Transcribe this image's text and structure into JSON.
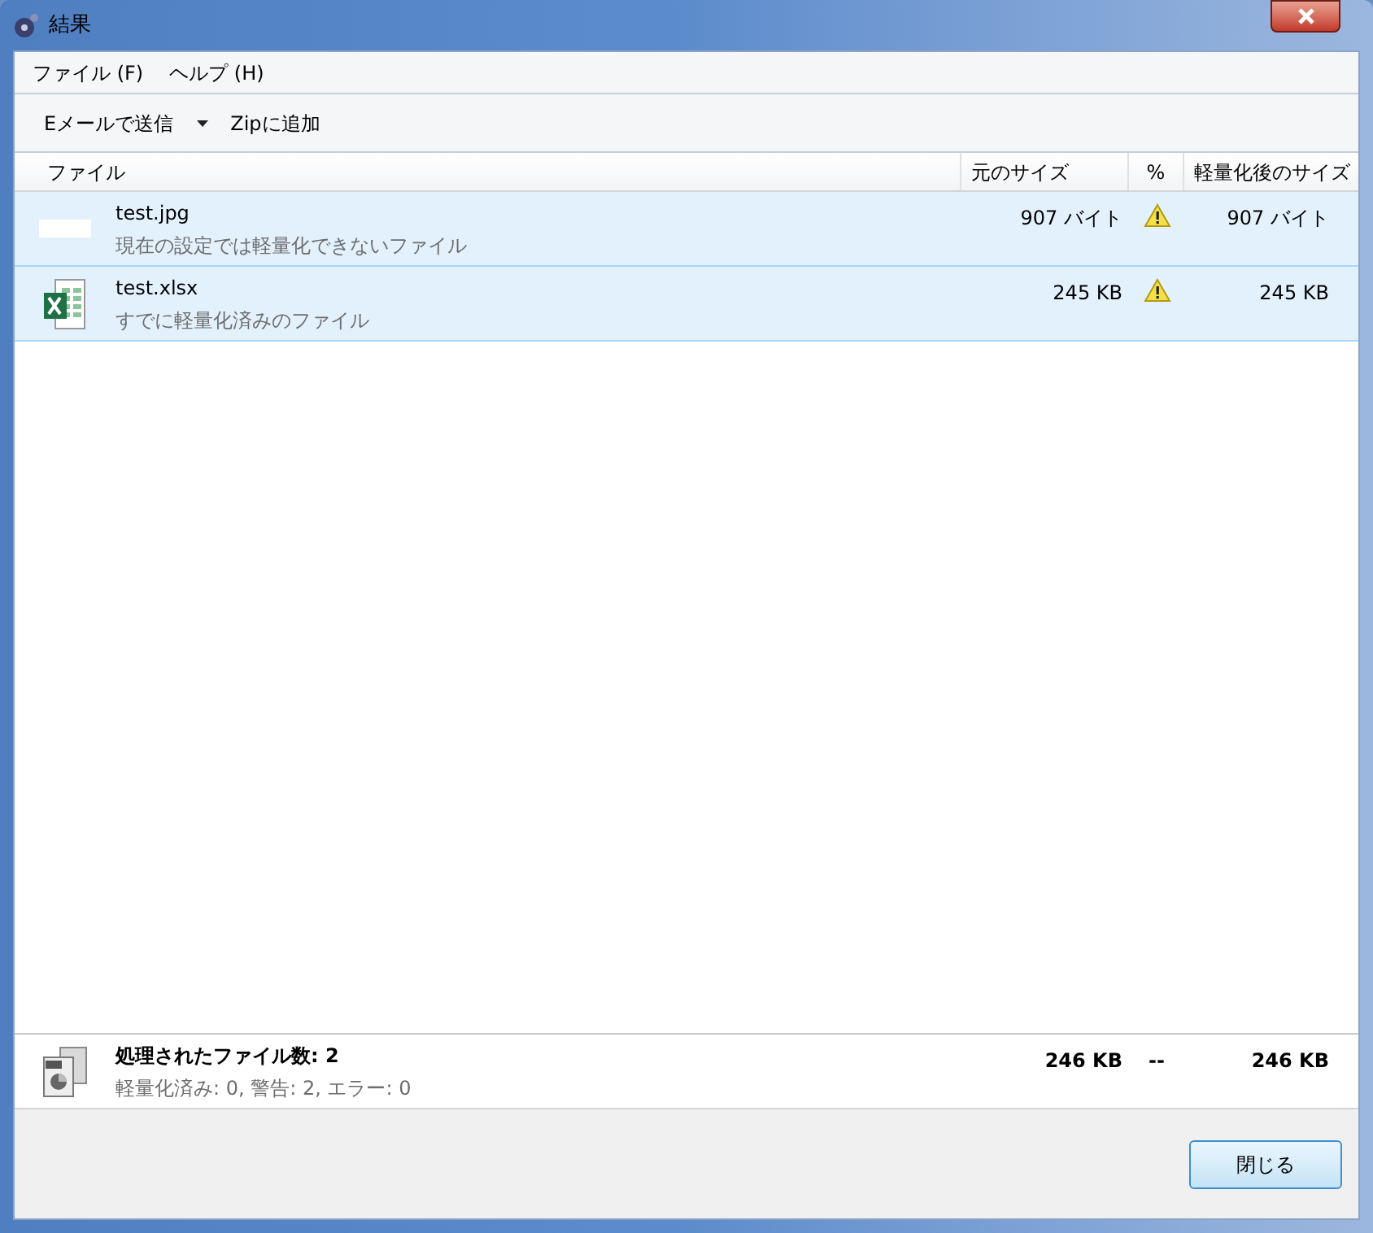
{
  "window": {
    "title": "結果"
  },
  "menu": [
    "ファイル (F)",
    "ヘルプ (H)"
  ],
  "toolbar": [
    {
      "label": "Eメールで送信",
      "dropdown": true
    },
    {
      "label": "Zipに追加",
      "dropdown": false
    }
  ],
  "table": {
    "columns": [
      "ファイル",
      "元のサイズ",
      "%",
      "軽量化後のサイズ"
    ],
    "rows": [
      {
        "kind": "image",
        "name": "test.jpg",
        "note": "現在の設定では軽量化できないファイル",
        "original": "907 バイト",
        "warning": true,
        "after": "907 バイト",
        "selected": true
      },
      {
        "kind": "spreadsheet",
        "name": "test.xlsx",
        "note": "すでに軽量化済みのファイル",
        "original": "245 KB",
        "warning": true,
        "after": "245 KB",
        "selected": true
      }
    ]
  },
  "summary": {
    "title": "処理されたファイル数: 2",
    "detail": "軽量化済み: 0, 警告: 2, エラー: 0",
    "original": "246 KB",
    "percent": "--",
    "after": "246 KB"
  },
  "buttons": [
    "閉じる"
  ]
}
